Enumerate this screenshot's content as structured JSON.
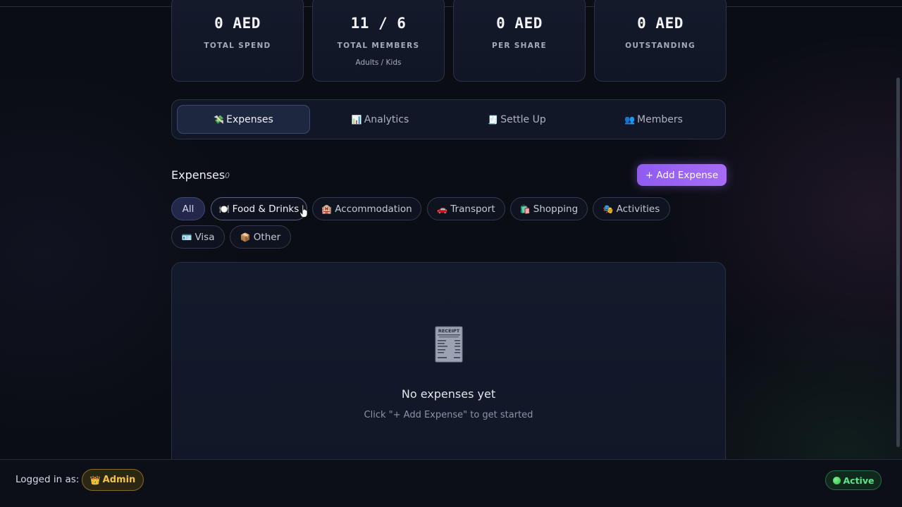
{
  "stats": [
    {
      "value": "0 AED",
      "label": "TOTAL SPEND",
      "sub": ""
    },
    {
      "value": "11 / 6",
      "label": "TOTAL MEMBERS",
      "sub": "Adults / Kids"
    },
    {
      "value": "0 AED",
      "label": "PER SHARE",
      "sub": ""
    },
    {
      "value": "0 AED",
      "label": "OUTSTANDING",
      "sub": ""
    }
  ],
  "tabs": [
    {
      "icon": "💸",
      "label": "Expenses",
      "active": true
    },
    {
      "icon": "📊",
      "label": "Analytics",
      "active": false
    },
    {
      "icon": "🧾",
      "label": "Settle Up",
      "active": false
    },
    {
      "icon": "👥",
      "label": "Members",
      "active": false
    }
  ],
  "expenses": {
    "title": "Expenses",
    "count": "0",
    "add_button": "+ Add Expense"
  },
  "filters": [
    {
      "icon": "",
      "label": "All"
    },
    {
      "icon": "🍽️",
      "label": "Food & Drinks"
    },
    {
      "icon": "🏨",
      "label": "Accommodation"
    },
    {
      "icon": "🚗",
      "label": "Transport"
    },
    {
      "icon": "🛍️",
      "label": "Shopping"
    },
    {
      "icon": "🎭",
      "label": "Activities"
    },
    {
      "icon": "🪪",
      "label": "Visa"
    },
    {
      "icon": "📦",
      "label": "Other"
    }
  ],
  "empty_state": {
    "icon": "receipt-icon",
    "receipt_text": "RECEIPT",
    "title": "No expenses yet",
    "subtitle": "Click \"+ Add Expense\" to get started"
  },
  "footer": {
    "logged_in_label": "Logged in as:",
    "role_icon": "👑",
    "role": "Admin",
    "status": "Active"
  },
  "colors": {
    "accent": "#9a63f5",
    "background": "#0b0d15",
    "admin": "#f2c44a",
    "status_active": "#5ee28d"
  }
}
